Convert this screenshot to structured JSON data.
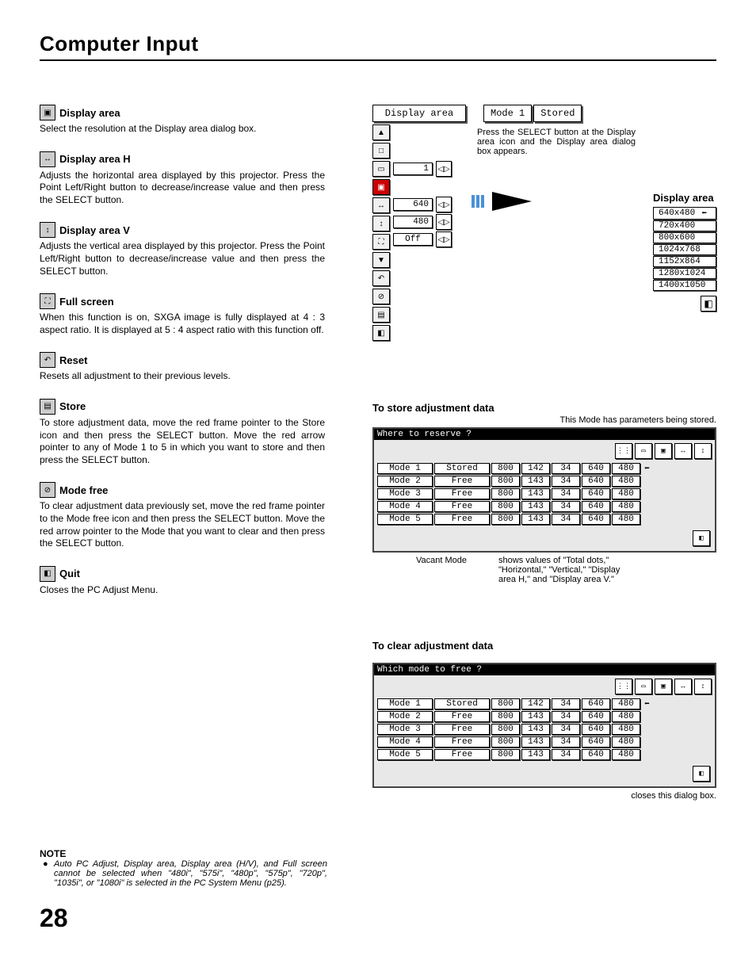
{
  "page_title": "Computer Input",
  "page_number": "28",
  "sections": {
    "display_area": {
      "title": "Display area",
      "body": "Select the resolution at the Display area dialog box."
    },
    "display_area_h": {
      "title": "Display area H",
      "body": "Adjusts the horizontal area displayed by this projector.  Press the Point Left/Right button to decrease/increase value and then press the SELECT button."
    },
    "display_area_v": {
      "title": "Display area V",
      "body": "Adjusts the vertical area displayed by this projector.  Press the Point Left/Right button to decrease/increase value and then press the SELECT button."
    },
    "full_screen": {
      "title": "Full screen",
      "body": "When this function is on, SXGA image is fully displayed at 4 : 3 aspect ratio.  It is displayed at 5 : 4 aspect ratio with this function off."
    },
    "reset": {
      "title": "Reset",
      "body": "Resets all adjustment to their previous levels."
    },
    "store": {
      "title": "Store",
      "body": "To store adjustment data, move the red frame pointer to the Store icon and then press the SELECT button.  Move the red arrow pointer to any of Mode 1 to 5 in which you want to store  and then press the SELECT button."
    },
    "mode_free": {
      "title": "Mode free",
      "body": "To clear adjustment data previously set, move the red frame pointer to the Mode free icon and then press the SELECT button.  Move the red arrow pointer to the Mode that you want to clear and then press the SELECT button."
    },
    "quit": {
      "title": "Quit",
      "body": "Closes the PC Adjust Menu."
    }
  },
  "osd": {
    "tabs": [
      "Display area",
      "Mode 1",
      "Stored"
    ],
    "note": "Press the SELECT button at the Display area icon and the Display area dialog box appears.",
    "values": {
      "v1": "1",
      "h": "640",
      "v": "480",
      "fs": "Off"
    },
    "res_panel_title": "Display area",
    "resolutions": [
      "640x480",
      "720x400",
      "800x600",
      "1024x768",
      "1152x864",
      "1280x1024",
      "1400x1050"
    ]
  },
  "store_section": {
    "heading": "To store adjustment data",
    "sub": "This Mode has parameters being stored.",
    "header": "Where to reserve ?",
    "rows": [
      {
        "name": "Mode 1",
        "status": "Stored",
        "v": [
          "800",
          "142",
          "34",
          "640",
          "480"
        ],
        "sel": true
      },
      {
        "name": "Mode 2",
        "status": "Free",
        "v": [
          "800",
          "143",
          "34",
          "640",
          "480"
        ]
      },
      {
        "name": "Mode 3",
        "status": "Free",
        "v": [
          "800",
          "143",
          "34",
          "640",
          "480"
        ]
      },
      {
        "name": "Mode 4",
        "status": "Free",
        "v": [
          "800",
          "143",
          "34",
          "640",
          "480"
        ]
      },
      {
        "name": "Mode 5",
        "status": "Free",
        "v": [
          "800",
          "143",
          "34",
          "640",
          "480"
        ]
      }
    ],
    "callout_left": "Vacant Mode",
    "callout_right": "shows values of \"Total dots,\" \"Horizontal,\" \"Vertical,\" \"Display area H,\" and \"Display area V.\""
  },
  "clear_section": {
    "heading": "To clear adjustment data",
    "header": "Which mode to free ?",
    "rows": [
      {
        "name": "Mode 1",
        "status": "Stored",
        "v": [
          "800",
          "142",
          "34",
          "640",
          "480"
        ],
        "sel": true
      },
      {
        "name": "Mode 2",
        "status": "Free",
        "v": [
          "800",
          "143",
          "34",
          "640",
          "480"
        ]
      },
      {
        "name": "Mode 3",
        "status": "Free",
        "v": [
          "800",
          "143",
          "34",
          "640",
          "480"
        ]
      },
      {
        "name": "Mode 4",
        "status": "Free",
        "v": [
          "800",
          "143",
          "34",
          "640",
          "480"
        ]
      },
      {
        "name": "Mode 5",
        "status": "Free",
        "v": [
          "800",
          "143",
          "34",
          "640",
          "480"
        ]
      }
    ],
    "callout": "closes this dialog box."
  },
  "note": {
    "title": "NOTE",
    "body": "Auto PC Adjust, Display area, Display area (H/V), and Full screen cannot be selected when \"480i\", \"575i\", \"480p\", \"575p\", \"720p\", \"1035i\", or \"1080i\" is selected in the PC System Menu (p25)."
  }
}
